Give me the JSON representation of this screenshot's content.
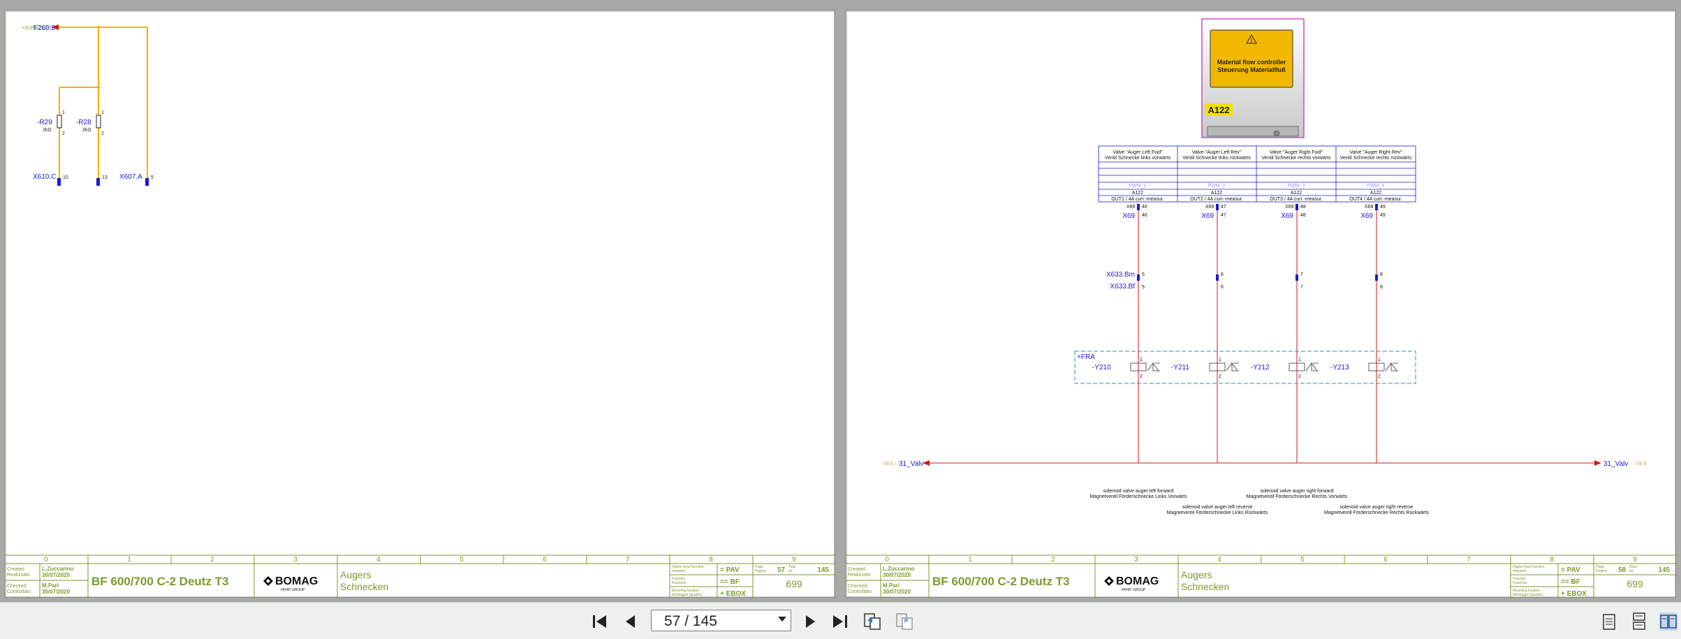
{
  "pages": {
    "left": {
      "circuit": {
        "top_ref_prefix": "+SUPL/21.9 /",
        "top_ref": "F260:2",
        "resistors": [
          {
            "name": "-R29",
            "value": "2kΩ",
            "pin_top": "1",
            "pin_bottom": "2"
          },
          {
            "name": "-R28",
            "value": "2kΩ",
            "pin_top": "1",
            "pin_bottom": "2"
          }
        ],
        "connectors": [
          {
            "label": "X610.C",
            "pin": "10"
          },
          {
            "label": "",
            "pin": "13"
          },
          {
            "label": "X607.A",
            "pin": "5"
          }
        ]
      },
      "title_block": {
        "grid_numbers": [
          "0",
          "1",
          "2",
          "3",
          "4",
          "5",
          "6",
          "7",
          "8",
          "9"
        ],
        "created_label": "Created",
        "created_label_it": "Realizzato",
        "checked_label": "Checked",
        "checked_label_it": "Controllato",
        "created_by": "L.Zuccarino",
        "created_date": "30/07/2020",
        "checked_by": "M.Pari",
        "checked_date": "30/07/2020",
        "project": "BF 600/700 C-2 Deutz T3",
        "logo_text": "BOMAG",
        "logo_sub": "FAYAT GROUP",
        "desc_en": "Augers",
        "desc_de": "Schnecken",
        "hl_function_label": "Higher-level function",
        "hl_function_label_it": "Impianto",
        "function_label": "Function",
        "function_label_it": "Funzione",
        "mounting_label": "Mounting location",
        "mounting_label_it": "Montaggio (quadro)",
        "hl_function": "PAV",
        "function": "BF",
        "mounting": "EBOX",
        "page_label": "Page",
        "page_label_it": "Pagina",
        "total_label": "Total",
        "total_label_it": "tot.",
        "page_num": "57",
        "total": "145",
        "drawing_no": "699"
      }
    },
    "right": {
      "device": {
        "title_line1": "Material flow controller",
        "title_line2": "Steuerung Materialfluß",
        "tag": "A122"
      },
      "valves": [
        {
          "hdr1": "Valve \"Auger Left Fwd\"",
          "hdr2": "Ventil Schnecke links vorwärts",
          "pwm": "PWM_1",
          "dev": "A122",
          "out": "OUT1   / 4A curr.-measur.",
          "x69_top_pin": "46",
          "x69_pin": "46",
          "x633_top_pin": "5",
          "x633_pin": "5",
          "coil": "-Y210"
        },
        {
          "hdr1": "Valve \"Auger Left Rev\"",
          "hdr2": "Ventil Schnecke links rückwärts",
          "pwm": "PWM_2",
          "dev": "A122",
          "out": "OUT2   / 4A curr.-measur.",
          "x69_top_pin": "47",
          "x69_pin": "47",
          "x633_top_pin": "6",
          "x633_pin": "6",
          "coil": "-Y211"
        },
        {
          "hdr1": "Valve \"Auger Right Fwd\"",
          "hdr2": "Ventil Schnecke rechts vorwärts",
          "pwm": "PWM_3",
          "dev": "A122",
          "out": "OUT3   / 4A curr.-measur.",
          "x69_top_pin": "48",
          "x69_pin": "48",
          "x633_top_pin": "7",
          "x633_pin": "7",
          "coil": "-Y212"
        },
        {
          "hdr1": "Valve \"Auger Right Rev\"",
          "hdr2": "Ventil Schnecke rechts rückwärts",
          "pwm": "PWM_4",
          "dev": "A122",
          "out": "OUT4   / 4A curr.-measur.",
          "x69_top_pin": "49",
          "x69_pin": "49",
          "x633_top_pin": "8",
          "x633_pin": "8",
          "coil": "-Y213"
        }
      ],
      "x69_small": "X69",
      "x69_label": "X69",
      "x633_bm": "X633.Bm",
      "x633_bf": "X633.Bf",
      "coil_pin_top": "1",
      "coil_pin_bottom": "2",
      "fra_label": "+FRA",
      "bus_left_ref": "59.6 /",
      "bus_left": "31_Valv",
      "bus_right": "31_Valv",
      "bus_right_ref": "/ 59.6",
      "notes": [
        {
          "en": "solenoid valve auger left forward",
          "de": "Magnetventil Förderschnecke Links Vorwärts"
        },
        {
          "en": "solenoid valve auger right forward",
          "de": "Magnetventil Förderschnecke Rechts Vorwärts"
        },
        {
          "en": "solenoid valve auger left reverse",
          "de": "Magnetventil Förderschnecke Links Rückwärts"
        },
        {
          "en": "solenoid valve auger right reverse",
          "de": "Magnetventil Förderschnecke Rechts Rückwärts"
        }
      ],
      "title_block": {
        "page_num": "58",
        "total": "145",
        "drawing_no": "699"
      }
    }
  },
  "toolbar": {
    "page_indicator": "57 / 145",
    "icons": [
      "first-page-icon",
      "previous-page-icon",
      "next-page-icon",
      "last-page-icon",
      "back-view-icon",
      "forward-view-icon",
      "single-page-view-icon",
      "continuous-view-icon",
      "two-page-view-icon"
    ]
  },
  "colors": {
    "green": "#7a9b2e",
    "blue": "#1a1ad6",
    "orange": "#f0b000",
    "red": "#d01818",
    "magenta": "#c020c0",
    "teal": "#2a9a8a"
  }
}
